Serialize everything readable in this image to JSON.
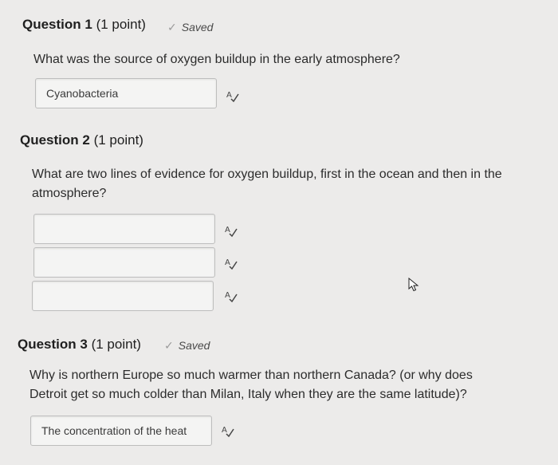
{
  "questions": [
    {
      "title": "Question 1",
      "points": "(1 point)",
      "saved_label": "Saved",
      "prompt": "What was the source of oxygen buildup in the early atmosphere?",
      "answers": [
        "Cyanobacteria"
      ]
    },
    {
      "title": "Question 2",
      "points": "(1 point)",
      "prompt_line1": "What are two lines of evidence for oxygen buildup, first in the ocean and then in the",
      "prompt_line2": "atmosphere?",
      "answers": [
        "",
        "",
        ""
      ]
    },
    {
      "title": "Question 3",
      "points": "(1 point)",
      "saved_label": "Saved",
      "prompt_line1": "Why is northern Europe so much warmer than northern Canada? (or why does",
      "prompt_line2": "Detroit get so much colder than Milan, Italy when they are the same latitude)?",
      "answers": [
        "The concentration of the heat"
      ]
    }
  ],
  "icons": {
    "saved": "checkmark-icon",
    "spellcheck": "spellcheck-icon",
    "cursor": "mouse-cursor-icon"
  }
}
